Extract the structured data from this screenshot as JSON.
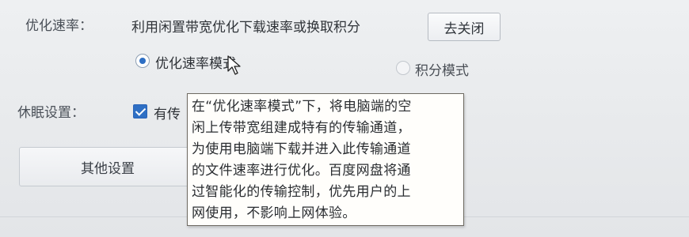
{
  "speed": {
    "label": "优化速率：",
    "description": "利用闲置带宽优化下载速率或换取积分",
    "close_button": "去关闭",
    "options": [
      {
        "label": "优化速率模式",
        "selected": true
      },
      {
        "label": "积分模式",
        "selected": false
      }
    ]
  },
  "sleep": {
    "label": "休眠设置：",
    "checkbox_label": "有传",
    "checked": true
  },
  "other_settings_button": "其他设置",
  "tooltip": {
    "lines": [
      "在“优化速率模式”下，将电脑端的空",
      "闲上传带宽组建成特有的传输通道，",
      "为使用电脑端下载并进入此传输通道",
      "的文件速率进行优化。百度网盘将通",
      "过智能化的传输控制，优先用户的上",
      "网使用，不影响上网体验。"
    ]
  },
  "colors": {
    "accent": "#2e6fc4",
    "tooltip_bg": "#fffefb"
  },
  "icons": {
    "cursor": "mouse-pointer-icon"
  }
}
